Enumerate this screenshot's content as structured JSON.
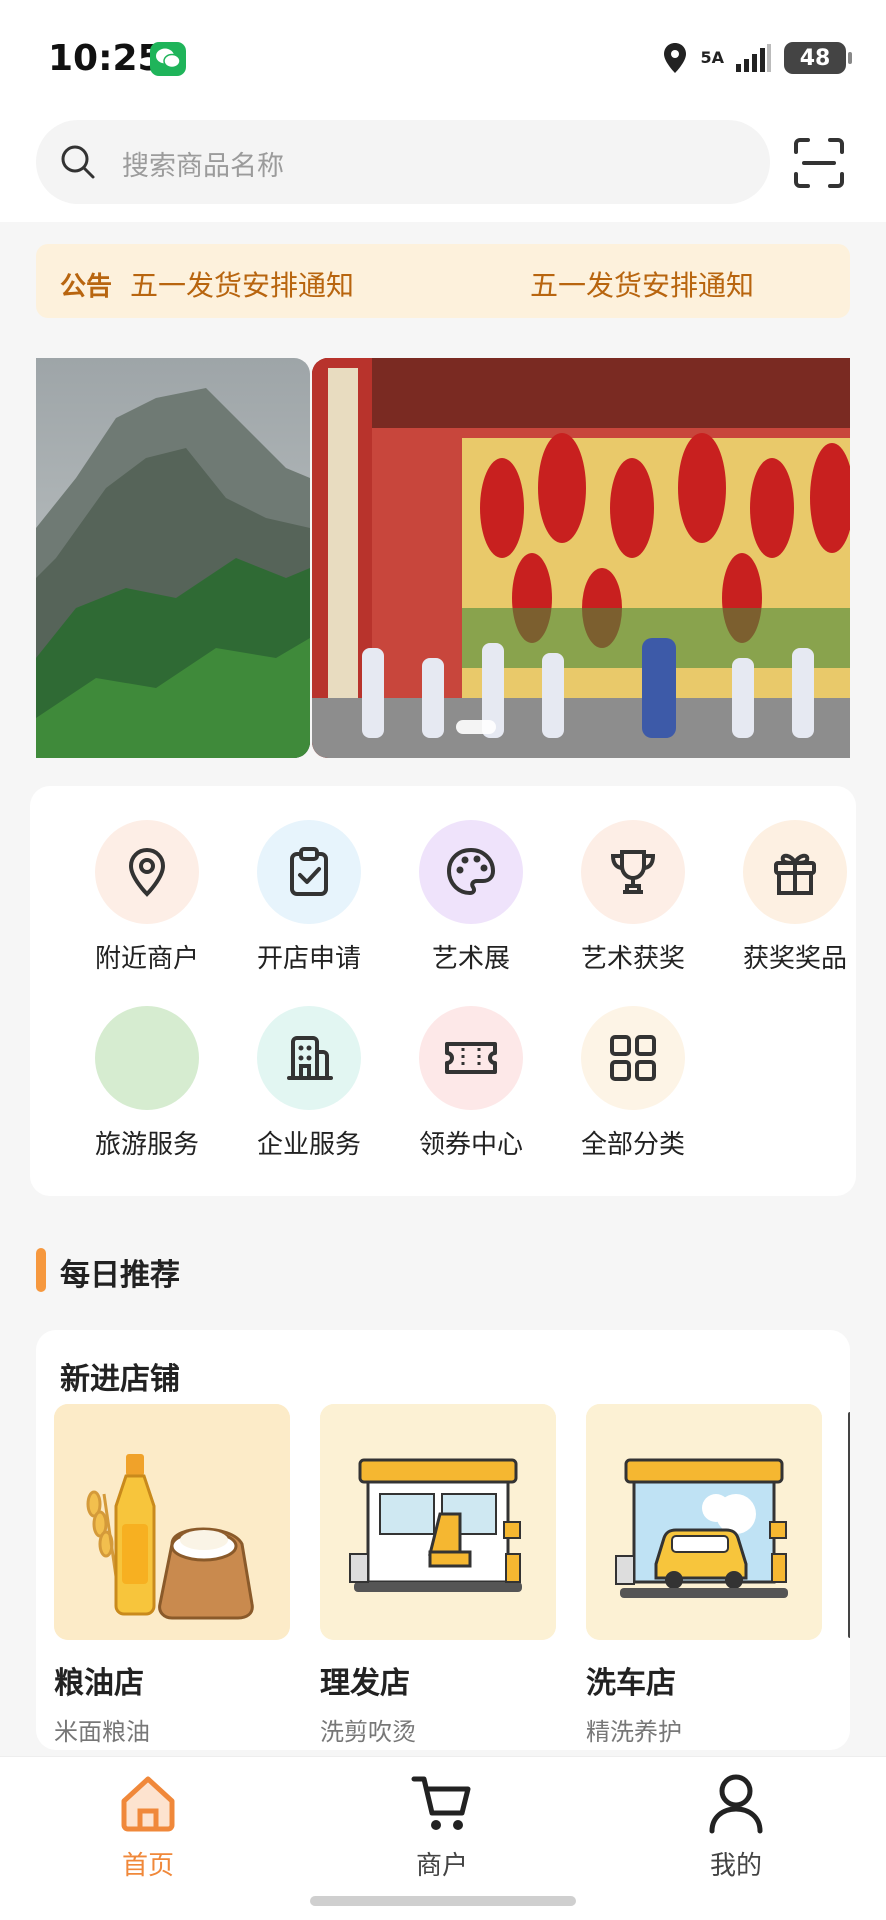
{
  "status_bar": {
    "time": "10:25",
    "network": "5A",
    "battery": "48"
  },
  "search": {
    "placeholder": "搜索商品名称"
  },
  "notice": {
    "tag": "公告",
    "items": [
      "五一发货安排通知",
      "五一发货安排通知"
    ]
  },
  "categories": [
    {
      "label": "附近商户",
      "icon": "location-pin-icon",
      "bg": "#fdeee6"
    },
    {
      "label": "开店申请",
      "icon": "clipboard-check-icon",
      "bg": "#e7f4fc"
    },
    {
      "label": "艺术展",
      "icon": "palette-icon",
      "bg": "#efe3fb"
    },
    {
      "label": "艺术获奖",
      "icon": "trophy-icon",
      "bg": "#fdeee6"
    },
    {
      "label": "获奖奖品",
      "icon": "gift-icon",
      "bg": "#fdf0e2"
    },
    {
      "label": "旅游服务",
      "icon": "travel-icon",
      "bg": "#d6ecd0"
    },
    {
      "label": "企业服务",
      "icon": "building-icon",
      "bg": "#e2f6f2"
    },
    {
      "label": "领券中心",
      "icon": "ticket-icon",
      "bg": "#fde8e8"
    },
    {
      "label": "全部分类",
      "icon": "grid-icon",
      "bg": "#fdf4e6"
    }
  ],
  "daily": {
    "title": "每日推荐"
  },
  "new_shops": {
    "title": "新进店铺",
    "items": [
      {
        "name": "粮油店",
        "desc": "米面粮油",
        "icon": "grain-oil-icon"
      },
      {
        "name": "理发店",
        "desc": "洗剪吹烫",
        "icon": "barber-shop-icon"
      },
      {
        "name": "洗车店",
        "desc": "精洗养护",
        "icon": "car-wash-icon"
      }
    ]
  },
  "tabbar": {
    "items": [
      {
        "label": "首页",
        "icon": "home-icon",
        "active": true
      },
      {
        "label": "商户",
        "icon": "cart-icon",
        "active": false
      },
      {
        "label": "我的",
        "icon": "user-icon",
        "active": false
      }
    ]
  },
  "colors": {
    "accent": "#f0883a",
    "notice_text": "#b8650f"
  }
}
